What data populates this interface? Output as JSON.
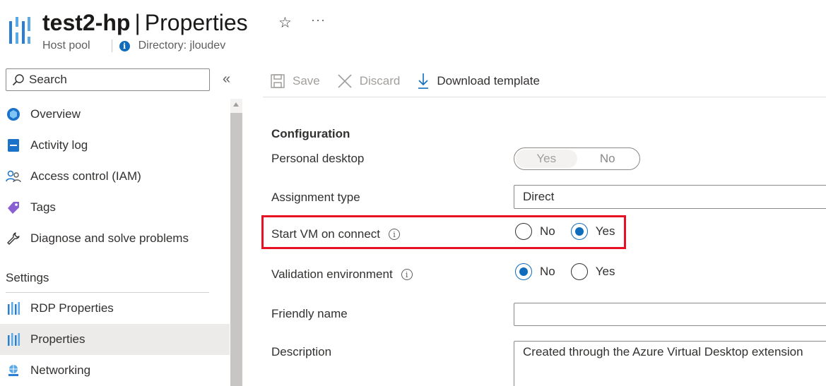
{
  "header": {
    "name": "test2-hp",
    "separator": "|",
    "page": "Properties",
    "subtitle": "Host pool",
    "directory": "Directory: jloudev",
    "favorite_icon": "star-icon",
    "more_label": "···"
  },
  "sidebar": {
    "search_placeholder": "Search",
    "collapse_label": "«",
    "items": [
      {
        "label": "Overview",
        "icon": "overview-icon"
      },
      {
        "label": "Activity log",
        "icon": "activity-log-icon"
      },
      {
        "label": "Access control (IAM)",
        "icon": "access-control-icon"
      },
      {
        "label": "Tags",
        "icon": "tag-icon"
      },
      {
        "label": "Diagnose and solve problems",
        "icon": "wrench-icon"
      }
    ],
    "section": "Settings",
    "settings_items": [
      {
        "label": "RDP Properties",
        "icon": "host-pool-icon"
      },
      {
        "label": "Properties",
        "icon": "host-pool-icon",
        "active": true
      },
      {
        "label": "Networking",
        "icon": "networking-icon"
      }
    ]
  },
  "toolbar": {
    "save_label": "Save",
    "discard_label": "Discard",
    "download_label": "Download template"
  },
  "form": {
    "section_title": "Configuration",
    "personal_desktop": {
      "label": "Personal desktop",
      "yes": "Yes",
      "no": "No",
      "selected": "Yes"
    },
    "assignment_type": {
      "label": "Assignment type",
      "value": "Direct"
    },
    "start_vm": {
      "label": "Start VM on connect",
      "no": "No",
      "yes": "Yes",
      "selected": "Yes"
    },
    "validation_env": {
      "label": "Validation environment",
      "no": "No",
      "yes": "Yes",
      "selected": "No"
    },
    "friendly_name": {
      "label": "Friendly name",
      "value": ""
    },
    "description": {
      "label": "Description",
      "value": "Created through the Azure Virtual Desktop extension"
    }
  },
  "colors": {
    "accent": "#0f6cbd",
    "highlight": "#e81123",
    "logo_blue": "#50a0e0"
  }
}
